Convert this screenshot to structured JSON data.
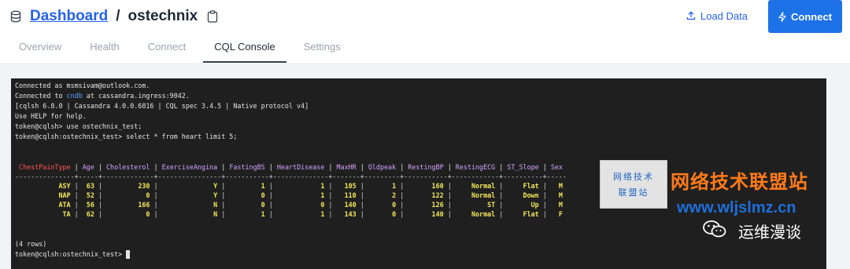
{
  "header": {
    "breadcrumb_link": "Dashboard",
    "separator": "/",
    "database": "ostechnix",
    "load_data_label": "Load Data",
    "connect_label": "Connect"
  },
  "tabs": [
    {
      "label": "Overview",
      "active": false
    },
    {
      "label": "Health",
      "active": false
    },
    {
      "label": "Connect",
      "active": false
    },
    {
      "label": "CQL Console",
      "active": true
    },
    {
      "label": "Settings",
      "active": false
    }
  ],
  "terminal": {
    "line1": "Connected as msmsivam@outlook.com.",
    "line2_pre": "Connected to ",
    "line2_db": "cndb",
    "line2_post": " at cassandra.ingress:9042.",
    "line3": "[cqlsh 6.8.0 | Cassandra 4.0.0.6816 | CQL spec 3.4.5 | Native protocol v4]",
    "line4": "Use HELP for help.",
    "line5": "token@cqlsh> use ostechnix_test;",
    "line6": "token@cqlsh:ostechnix_test> select * from heart limit 5;",
    "columns": [
      "ChestPainType",
      "Age",
      "Cholesterol",
      "ExerciseAngina",
      "FastingBS",
      "HeartDisease",
      "MaxHR",
      "Oldpeak",
      "RestingBP",
      "RestingECG",
      "ST_Slope",
      "Sex"
    ],
    "separator": "---------------+-----+-------------+----------------+-----------+--------------+-------+---------+-----------+------------+----------+-----",
    "rows": [
      [
        "ASY",
        "63",
        "230",
        "Y",
        "1",
        "1",
        "105",
        "1",
        "160",
        "Normal",
        "Flat",
        "M"
      ],
      [
        "NAP",
        "52",
        "0",
        "Y",
        "0",
        "1",
        "110",
        "2",
        "122",
        "Normal",
        "Down",
        "M"
      ],
      [
        "ATA",
        "56",
        "166",
        "N",
        "0",
        "0",
        "140",
        "0",
        "126",
        "ST",
        "Up",
        "M"
      ],
      [
        "TA",
        "62",
        "0",
        "N",
        "1",
        "1",
        "143",
        "0",
        "140",
        "Normal",
        "Flat",
        "F"
      ]
    ],
    "row_count": "(4 rows)",
    "prompt": "token@cqlsh:ostechnix_test> "
  },
  "watermark": {
    "box_line1": "网络技术",
    "box_line2": "联盟站",
    "title": "网络技术联盟站",
    "url": "www.wljslmz.cn",
    "account": "运维漫谈"
  }
}
